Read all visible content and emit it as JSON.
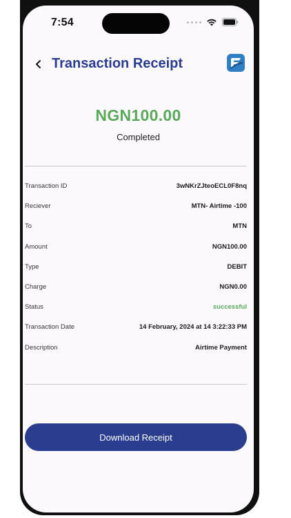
{
  "status_bar": {
    "time": "7:54"
  },
  "header": {
    "title": "Transaction Receipt",
    "back_icon": "chevron-left-icon",
    "logo_icon": "app-logo-icon"
  },
  "summary": {
    "amount": "NGN100.00",
    "status": "Completed",
    "amount_color": "#5aa95a"
  },
  "details": [
    {
      "label": "Transaction ID",
      "value": "3wNKrZJteoECL0F8nq"
    },
    {
      "label": "Reciever",
      "value": "MTN- Airtime -100"
    },
    {
      "label": "To",
      "value": "MTN"
    },
    {
      "label": "Amount",
      "value": "NGN100.00"
    },
    {
      "label": "Type",
      "value": "DEBIT"
    },
    {
      "label": "Charge",
      "value": "NGN0.00"
    },
    {
      "label": "Status",
      "value": "successful"
    },
    {
      "label": "Transaction Date",
      "value": "14 February, 2024 at 14 3:22:33 PM"
    },
    {
      "label": "Description",
      "value": "Airtime Payment"
    }
  ],
  "actions": {
    "download_label": "Download Receipt"
  },
  "colors": {
    "brand": "#2a3d8e",
    "success": "#5aa95a",
    "background": "#fcf9fd"
  }
}
